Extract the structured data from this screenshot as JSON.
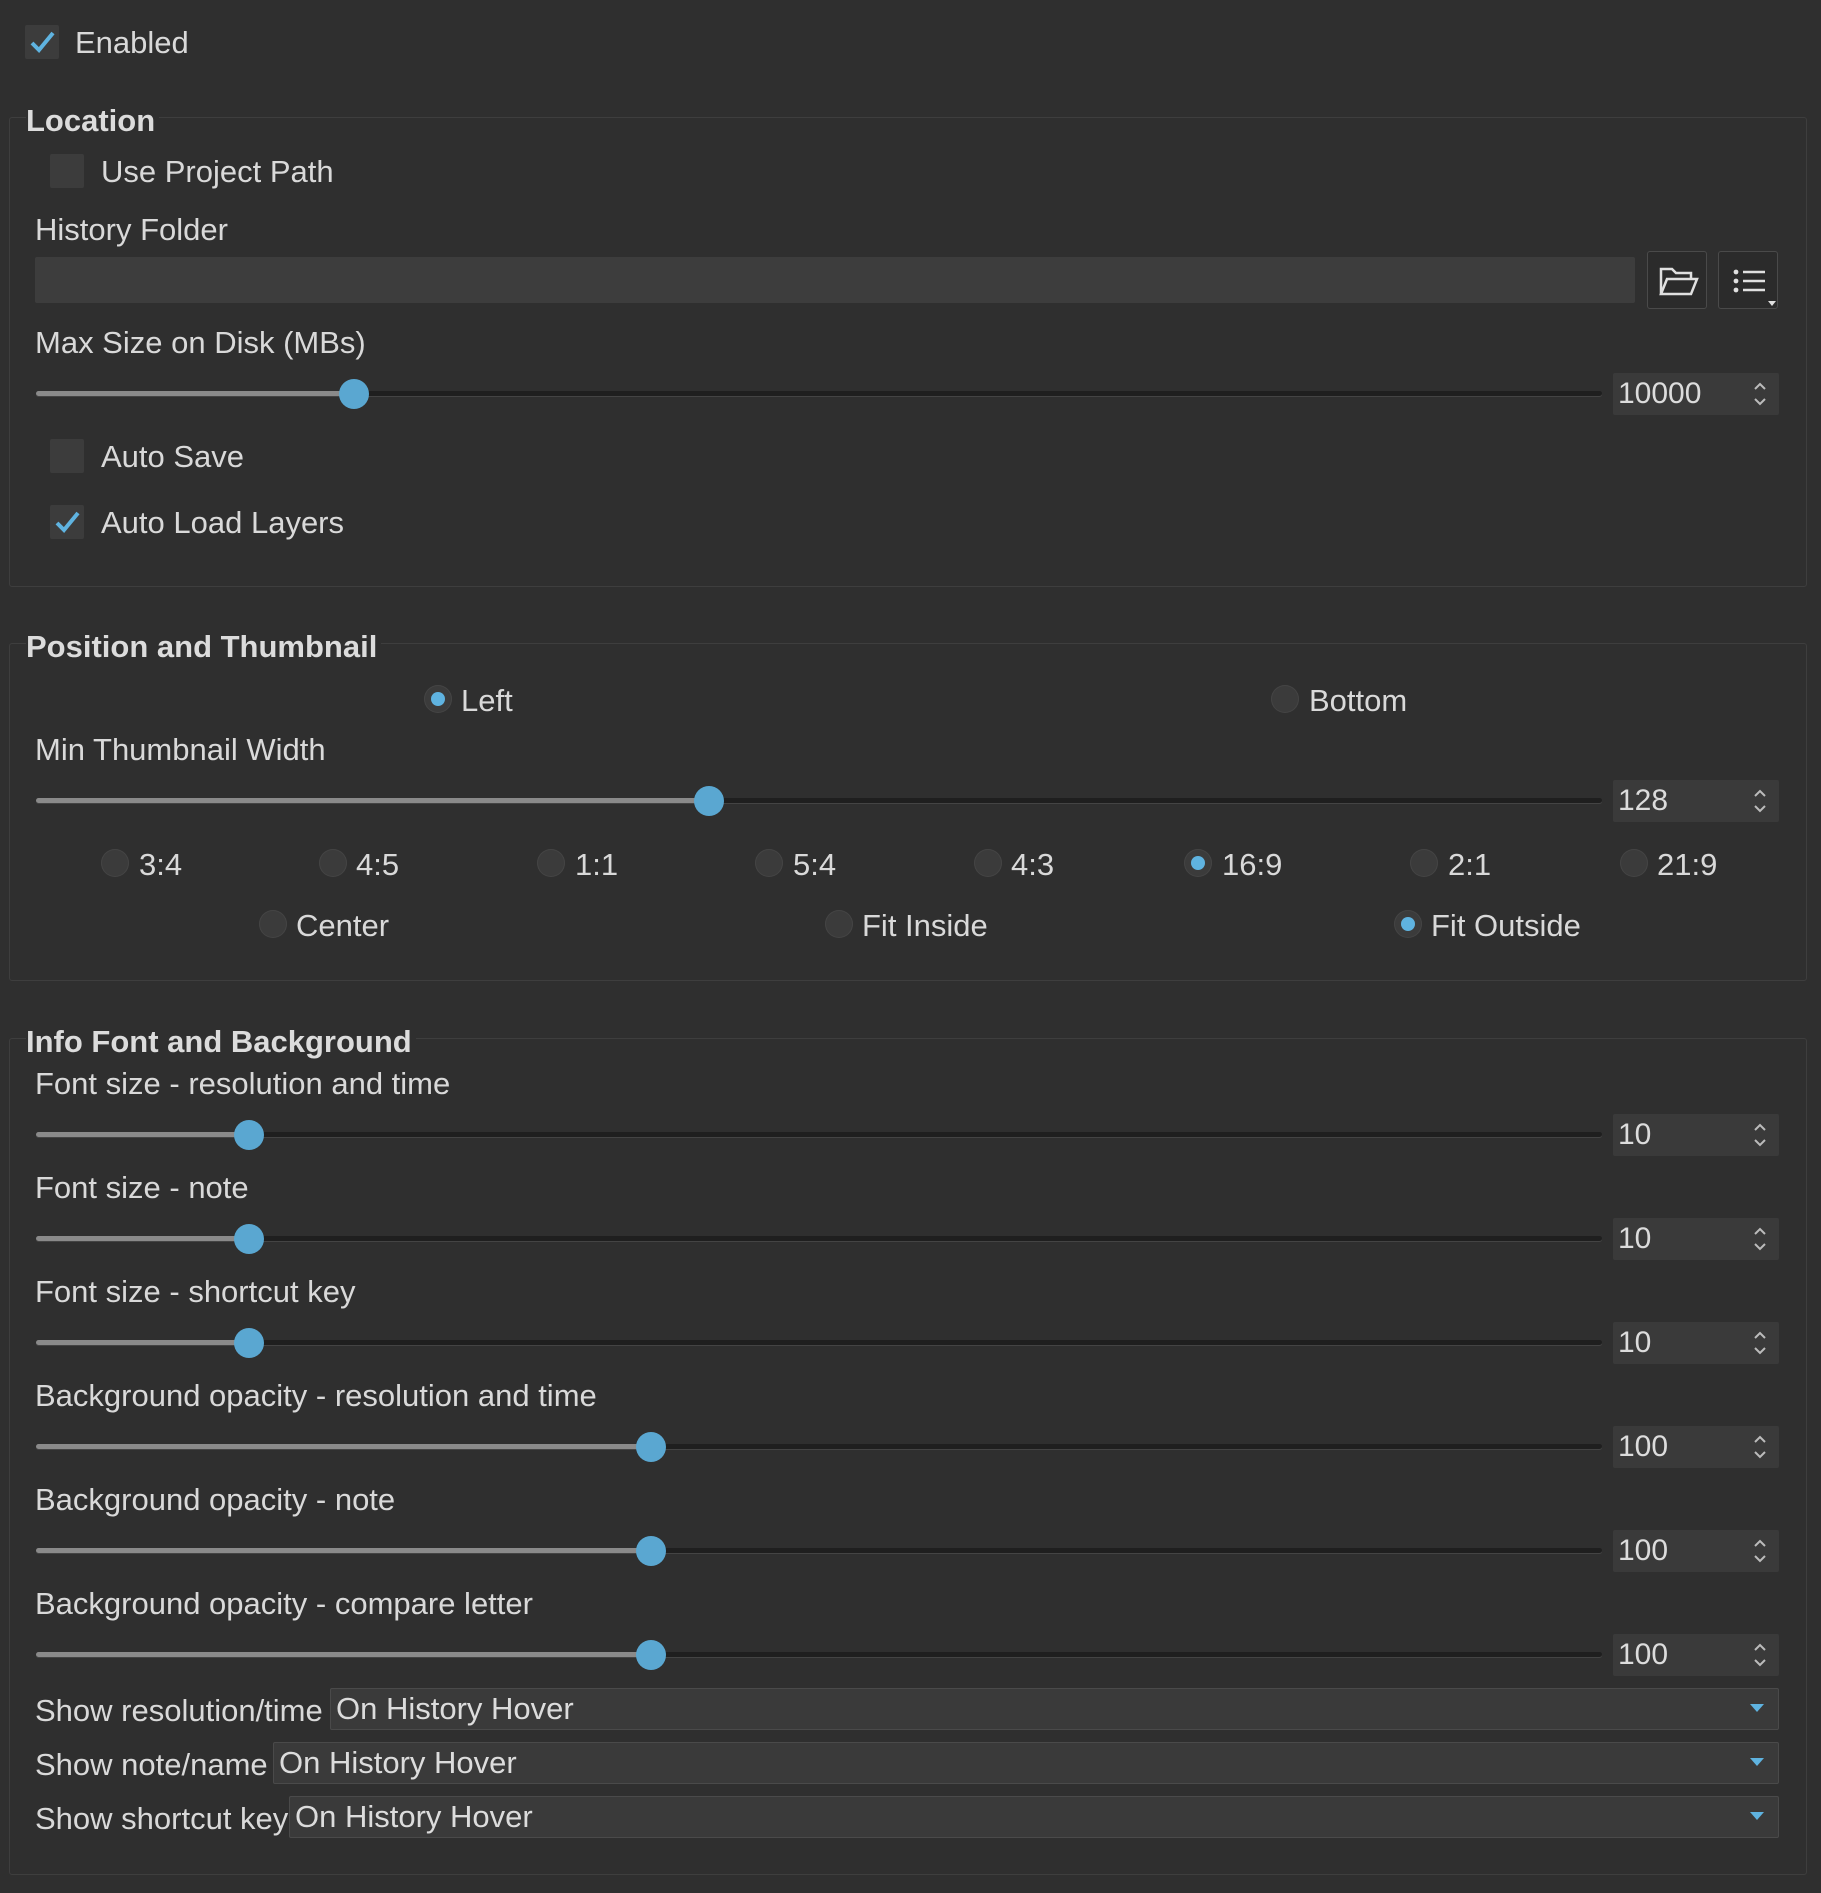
{
  "enabled": {
    "label": "Enabled",
    "checked": true
  },
  "location": {
    "title": "Location",
    "use_project_path": {
      "label": "Use Project Path",
      "checked": false
    },
    "history_folder_label": "History Folder",
    "history_folder_value": "",
    "max_size_label": "Max Size on Disk (MBs)",
    "max_size_value": "10000",
    "max_size_fraction": 0.203,
    "auto_save": {
      "label": "Auto Save",
      "checked": false
    },
    "auto_load_layers": {
      "label": "Auto Load Layers",
      "checked": true
    },
    "icons": {
      "browse": "folder-open-icon",
      "menu": "list-menu-icon"
    }
  },
  "position_thumbnail": {
    "title": "Position and Thumbnail",
    "position_options": [
      {
        "label": "Left",
        "selected": true
      },
      {
        "label": "Bottom",
        "selected": false
      }
    ],
    "min_thumb_label": "Min Thumbnail Width",
    "min_thumb_value": "128",
    "min_thumb_fraction": 0.43,
    "aspect_options": [
      {
        "label": "3:4",
        "selected": false
      },
      {
        "label": "4:5",
        "selected": false
      },
      {
        "label": "1:1",
        "selected": false
      },
      {
        "label": "5:4",
        "selected": false
      },
      {
        "label": "4:3",
        "selected": false
      },
      {
        "label": "16:9",
        "selected": true
      },
      {
        "label": "2:1",
        "selected": false
      },
      {
        "label": "21:9",
        "selected": false
      }
    ],
    "fit_options": [
      {
        "label": "Center",
        "selected": false
      },
      {
        "label": "Fit Inside",
        "selected": false
      },
      {
        "label": "Fit Outside",
        "selected": true
      }
    ]
  },
  "info_font": {
    "title": "Info Font and Background",
    "sliders": [
      {
        "label": "Font size - resolution and time",
        "value": "10",
        "fraction": 0.136
      },
      {
        "label": "Font size - note",
        "value": "10",
        "fraction": 0.136
      },
      {
        "label": "Font size - shortcut key",
        "value": "10",
        "fraction": 0.136
      },
      {
        "label": "Background opacity - resolution and time",
        "value": "100",
        "fraction": 0.393
      },
      {
        "label": "Background opacity - note",
        "value": "100",
        "fraction": 0.393
      },
      {
        "label": "Background opacity - compare letter",
        "value": "100",
        "fraction": 0.393
      }
    ],
    "combos": [
      {
        "label": "Show resolution/time",
        "value": "On History Hover"
      },
      {
        "label": "Show note/name",
        "value": "On History Hover"
      },
      {
        "label": "Show shortcut key",
        "value": "On History Hover"
      }
    ]
  },
  "colors": {
    "accent": "#5aa7d1",
    "background": "#2f2f2f",
    "field": "#3a3a3a"
  }
}
